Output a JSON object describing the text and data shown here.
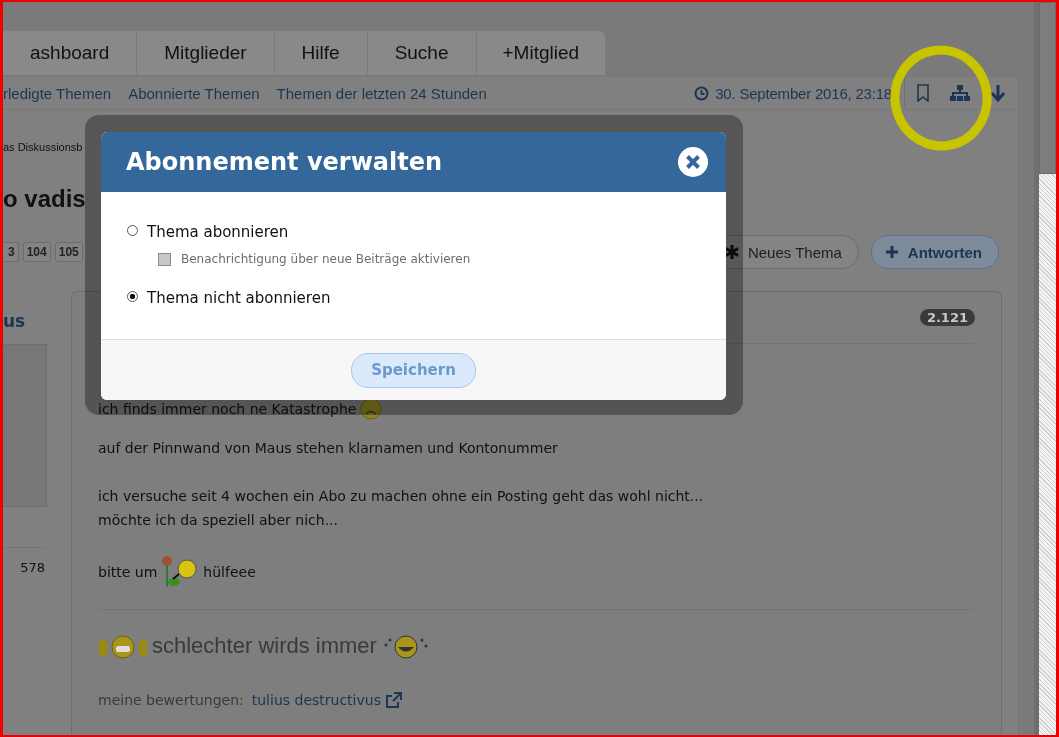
{
  "tabs": [
    {
      "label": "ashboard",
      "selected": false
    },
    {
      "label": "Mitglieder",
      "selected": false
    },
    {
      "label": "Hilfe",
      "selected": false
    },
    {
      "label": "Suche",
      "selected": false
    },
    {
      "label": "+Mitglied",
      "selected": false
    }
  ],
  "subnav": {
    "links": [
      "rledigte Themen",
      "Abonnierte Themen",
      "Themen der letzten 24 Stunden"
    ],
    "datetime": "30. September 2016, 23:18"
  },
  "breadcrumb": "as Diskussionsb",
  "thread_title": "o vadis",
  "pagination": [
    "3",
    "104",
    "105"
  ],
  "actions": [
    {
      "label": "Neues Thema",
      "kind": "default"
    },
    {
      "label": "Antworten",
      "kind": "primary"
    }
  ],
  "post": {
    "author": "us",
    "post_count": "578",
    "number_badge": "2.121",
    "paragraphs": [
      "ich finds immer noch ne Katastrophe",
      "auf der Pinnwand von Maus stehen klarnamen und Kontonummer",
      "ich versuche seit 4 wochen ein Abo zu machen ohne ein Posting geht das wohl nicht...\nmöchte ich da speziell aber nich..."
    ],
    "plea": {
      "before": "bitte um",
      "after": "hülfeee"
    },
    "signature": {
      "headline": "schlechter wirds immer",
      "ratings_label": "meine bewertungen:",
      "ratings_link": "tulius destructivus"
    }
  },
  "modal": {
    "title": "Abonnement verwalten",
    "options": [
      {
        "label": "Thema abonnieren",
        "selected": false,
        "sub_option": {
          "label": "Benachrichtigung über neue Beiträge aktivieren",
          "checked": false,
          "disabled": true
        }
      },
      {
        "label": "Thema nicht abonnieren",
        "selected": true
      }
    ],
    "save_button": "Speichern"
  }
}
